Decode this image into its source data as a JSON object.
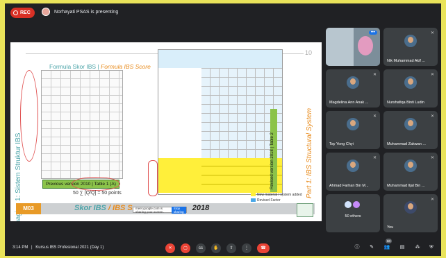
{
  "topbar": {
    "rec_label": "REC",
    "presenter_text": "Norhayati PSAS is presenting"
  },
  "slide": {
    "number": "10",
    "title_left": "Formula Skor IBS",
    "title_sep": " | ",
    "title_right": "Formula IBS Score",
    "vertical_left": "Bahagian 1: Sistem Struktur IBS",
    "vertical_right": "Part 1: IBS Structural System",
    "previous_version": "Previous version 2010 | Table 1 (A)",
    "formula": "50 ∑ [Q/Q] = 50 points",
    "revised_version": "Revised version 2018 | Table 2",
    "legend": [
      "New material / system added",
      "Revised Factor"
    ],
    "module": "M03",
    "footer_title_1": "Skor IBS",
    "footer_title_sep": " / ",
    "footer_title_2": "IBS S",
    "footer_title_year": "2018",
    "share_text": "meet.google.com is sharing your screen.",
    "share_button": "Stop sharing"
  },
  "participants": [
    {
      "name": "",
      "self_view": true
    },
    {
      "name": "Nik Muhammad Akif ..."
    },
    {
      "name": "Magdelina Ann Anak ..."
    },
    {
      "name": "Nurshafiqa Binti Ludin"
    },
    {
      "name": "Tay Yong Chyi"
    },
    {
      "name": "Muhammad Zakwan ..."
    },
    {
      "name": "Ahmad Farhan Bin M..."
    },
    {
      "name": "Muhammad Iljal Bin ..."
    },
    {
      "name": "50 others"
    },
    {
      "name": "You"
    }
  ],
  "bottom": {
    "time": "3:14 PM",
    "separator": "|",
    "meeting_title": "Kursus IBS Profesional 2021 (Day 1)",
    "participants_badge": "60"
  }
}
